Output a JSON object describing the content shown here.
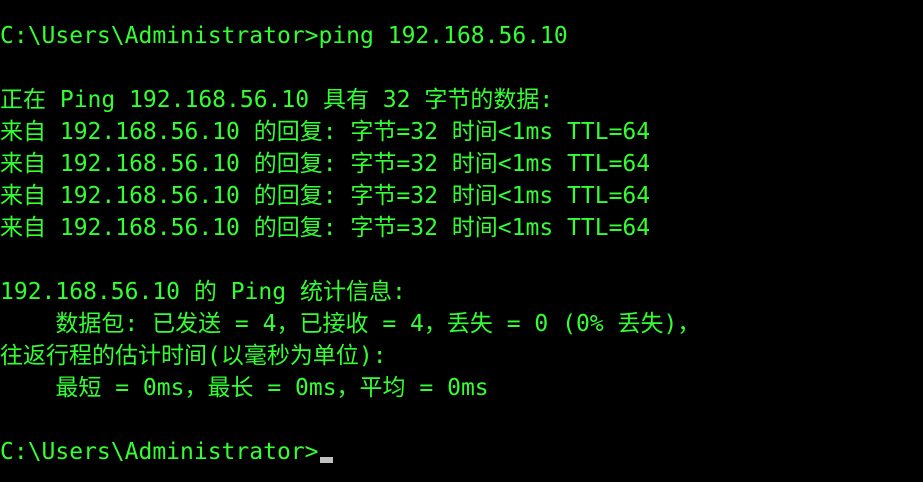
{
  "colors": {
    "background": "#000000",
    "text": "#33ff33",
    "cursor": "#c0c0c0"
  },
  "console": {
    "lines": [
      "C:\\Users\\Administrator>ping 192.168.56.10",
      "",
      "正在 Ping 192.168.56.10 具有 32 字节的数据:",
      "来自 192.168.56.10 的回复: 字节=32 时间<1ms TTL=64",
      "来自 192.168.56.10 的回复: 字节=32 时间<1ms TTL=64",
      "来自 192.168.56.10 的回复: 字节=32 时间<1ms TTL=64",
      "来自 192.168.56.10 的回复: 字节=32 时间<1ms TTL=64",
      "",
      "192.168.56.10 的 Ping 统计信息:",
      "    数据包: 已发送 = 4，已接收 = 4，丢失 = 0 (0% 丢失)，",
      "往返行程的估计时间(以毫秒为单位):",
      "    最短 = 0ms，最长 = 0ms，平均 = 0ms",
      "",
      "C:\\Users\\Administrator>"
    ]
  }
}
